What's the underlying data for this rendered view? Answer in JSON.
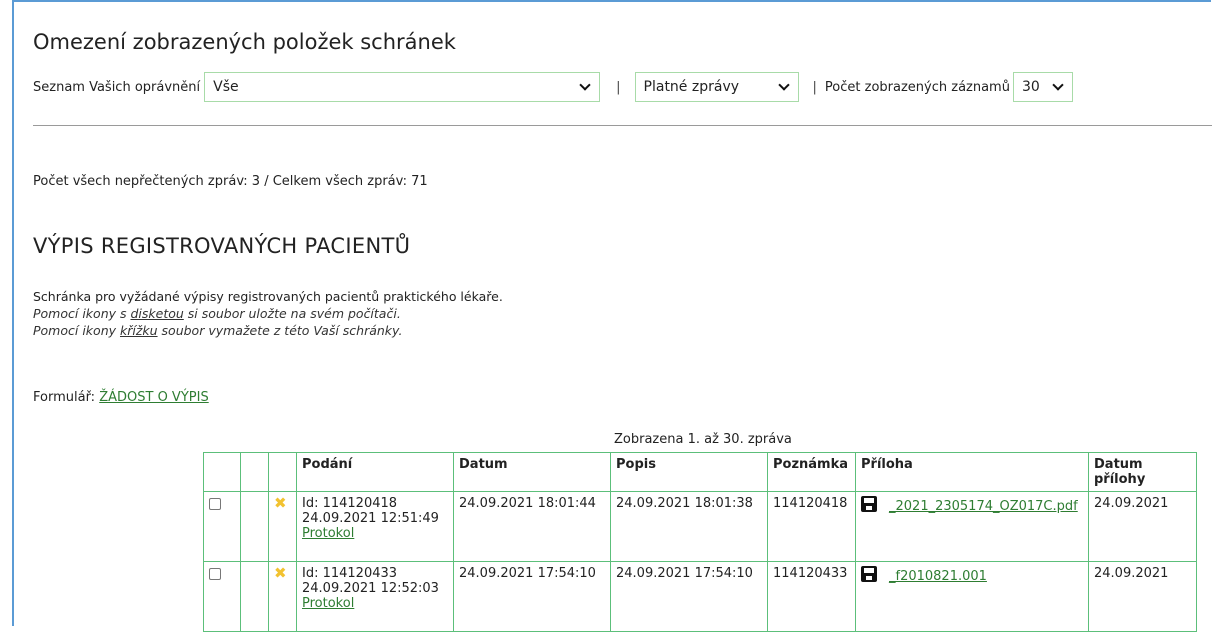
{
  "filter": {
    "heading": "Omezení zobrazených položek schránek",
    "permissions_label": "Seznam Vašich oprávnění",
    "permissions_value": "Vše",
    "separator": "|",
    "status_value": "Platné zprávy",
    "count_label": "Počet zobrazených záznamů",
    "count_value": "30"
  },
  "counts_text": "Počet všech nepřečtených zpráv: 3 / Celkem všech zpráv: 71",
  "section": {
    "title": "VÝPIS REGISTROVANÝCH PACIENTŮ",
    "desc_line1": "Schránka pro vyžádané výpisy registrovaných pacientů praktického lékaře.",
    "desc_line2_pre": "Pomocí ikony s ",
    "desc_line2_link": "disketou",
    "desc_line2_post": " si soubor uložte na svém počítači.",
    "desc_line3_pre": "Pomocí ikony ",
    "desc_line3_link": "křížku",
    "desc_line3_post": " soubor vymažete z této Vaší schránky."
  },
  "form": {
    "label": "Formulář: ",
    "link": "ŽÁDOST O VÝPIS"
  },
  "table": {
    "caption": "Zobrazena 1. až 30. zpráva",
    "headers": [
      "Podání",
      "Datum",
      "Popis",
      "Poznámka",
      "Příloha",
      "Datum přílohy"
    ],
    "rows": [
      {
        "id": "Id: 114120418",
        "submitted": "24.09.2021 12:51:49",
        "protocol": "Protokol",
        "date": "24.09.2021 18:01:44",
        "desc": "24.09.2021 18:01:38",
        "note": "114120418",
        "attachment": "_2021_2305174_OZ017C.pdf",
        "attachment_date": "24.09.2021"
      },
      {
        "id": "Id: 114120433",
        "submitted": "24.09.2021 12:52:03",
        "protocol": "Protokol",
        "date": "24.09.2021 17:54:10",
        "desc": "24.09.2021 17:54:10",
        "note": "114120433",
        "attachment": "_f2010821.001",
        "attachment_date": "24.09.2021"
      }
    ]
  },
  "icons": {
    "delete": "x-icon",
    "save": "floppy-disk-icon",
    "delete_color": "#f2c230"
  }
}
